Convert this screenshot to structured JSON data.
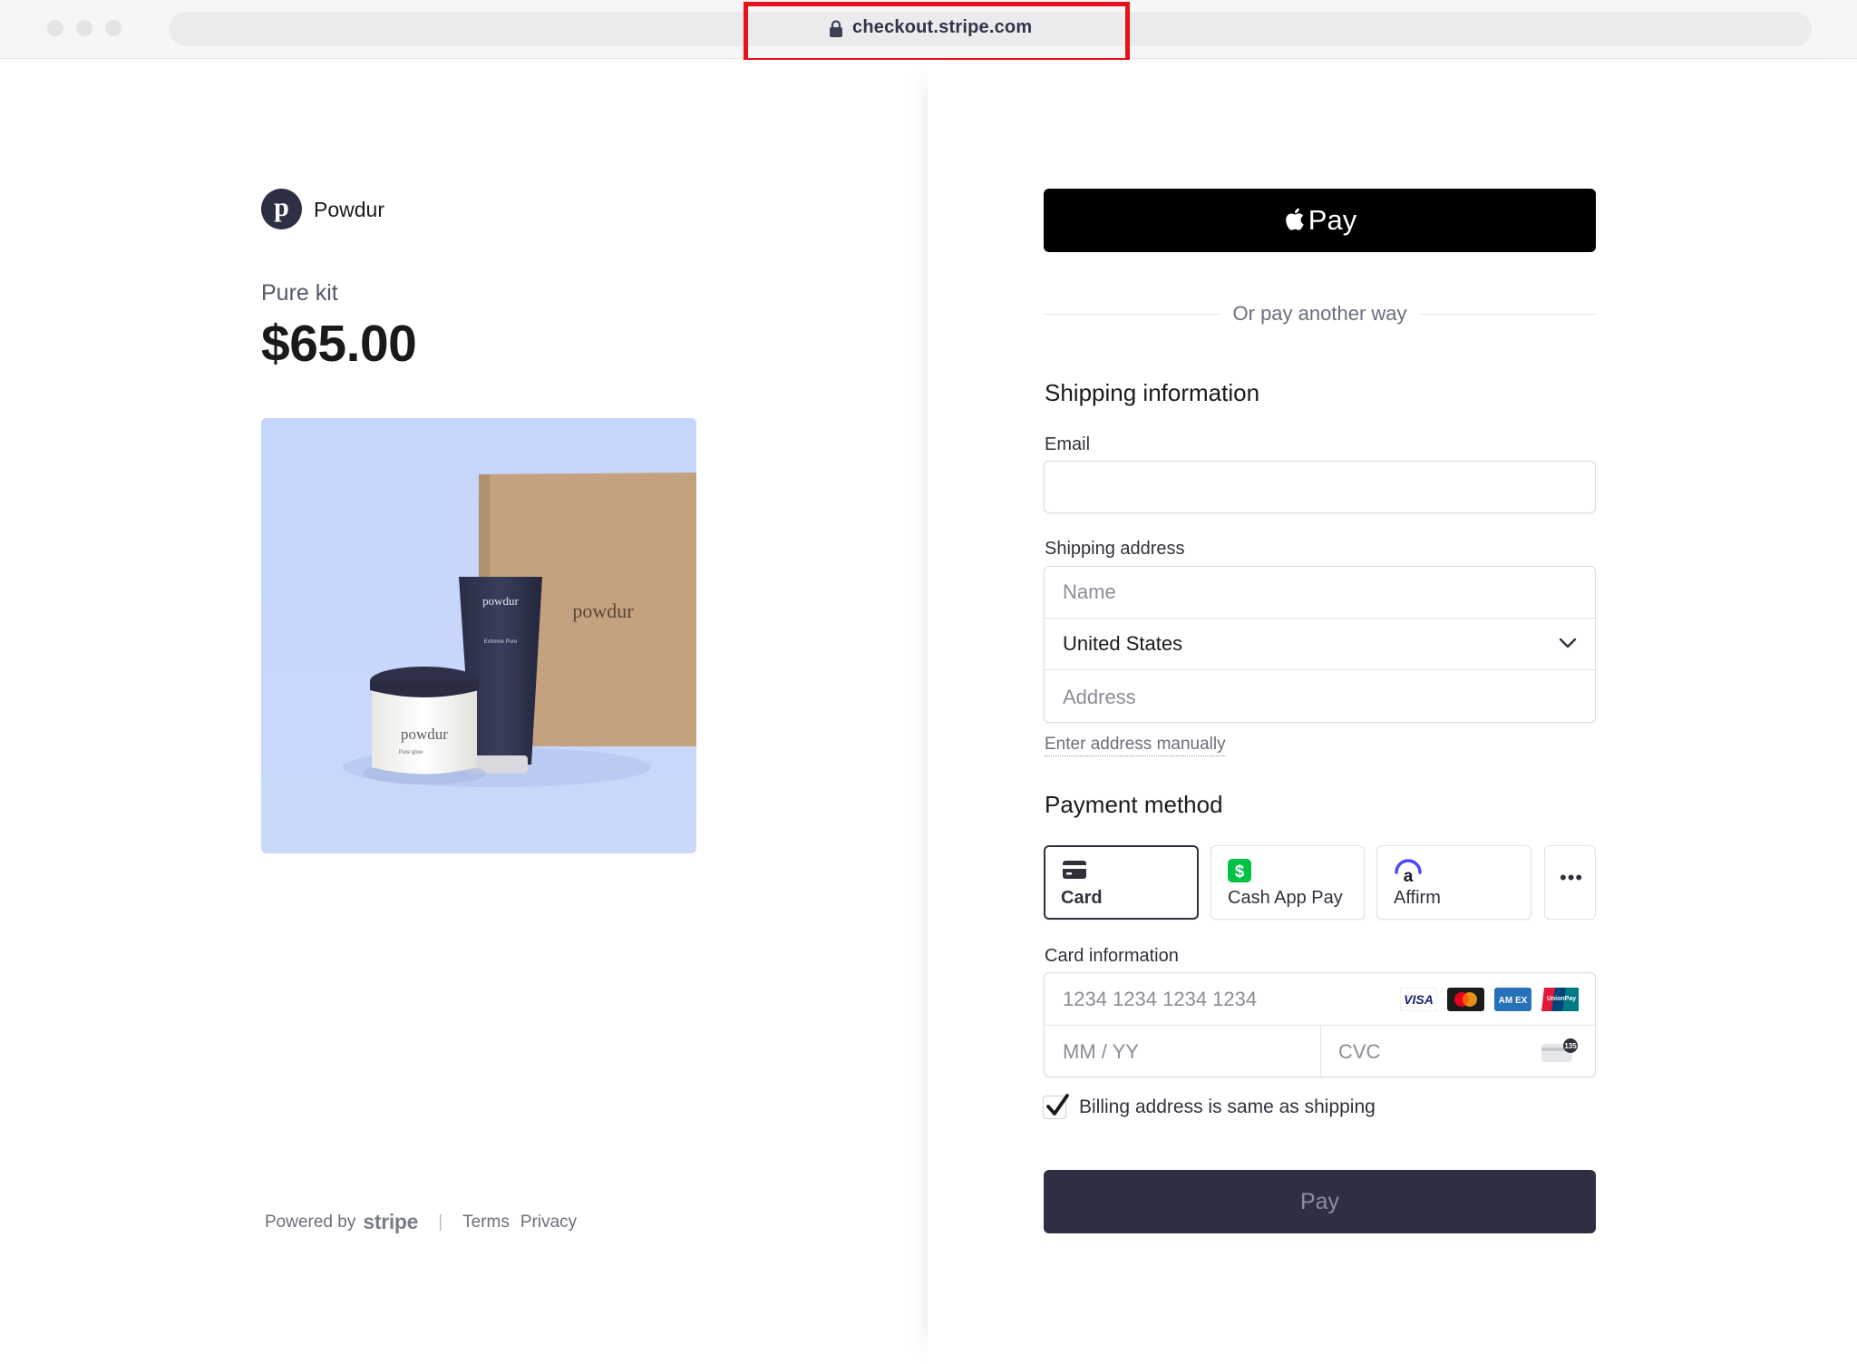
{
  "browser": {
    "url": "checkout.stripe.com"
  },
  "merchant": {
    "initial": "p",
    "name": "Powdur"
  },
  "product": {
    "name": "Pure kit",
    "price": "$65.00",
    "image_text": {
      "box_brand": "powdur",
      "tube_brand": "powdur",
      "tube_sub": "Extreme Pure",
      "jar_brand": "powdur",
      "jar_sub": "Pure glow"
    }
  },
  "footer": {
    "powered_by": "Powered by",
    "stripe": "stripe",
    "separator": "|",
    "terms": "Terms",
    "privacy": "Privacy"
  },
  "checkout": {
    "apple_pay_label": "Pay",
    "divider_text": "Or pay another way",
    "shipping_title": "Shipping information",
    "email_label": "Email",
    "email_value": "",
    "shipping_address_label": "Shipping address",
    "name_placeholder": "Name",
    "country_value": "United States",
    "address_placeholder": "Address",
    "manual_link": "Enter address manually",
    "payment_title": "Payment method",
    "payment_methods": [
      {
        "label": "Card",
        "icon": "card-icon",
        "selected": true
      },
      {
        "label": "Cash App Pay",
        "icon": "cash-app-icon",
        "selected": false
      },
      {
        "label": "Affirm",
        "icon": "affirm-icon",
        "selected": false
      }
    ],
    "more_label": "•••",
    "card_info_label": "Card information",
    "card_number_placeholder": "1234 1234 1234 1234",
    "card_brands": [
      "VISA",
      "Mastercard",
      "AMEX",
      "UnionPay"
    ],
    "expiry_placeholder": "MM / YY",
    "cvc_placeholder": "CVC",
    "cvc_hint": "135",
    "billing_same_label": "Billing address is same as shipping",
    "billing_same_checked": true,
    "pay_button": "Pay"
  },
  "colors": {
    "accent_dark": "#2f2f44",
    "highlight_red": "#e8101a",
    "product_bg": "#c8d7fb",
    "cash_app_green": "#00c244",
    "affirm_blue": "#4a4af4"
  }
}
